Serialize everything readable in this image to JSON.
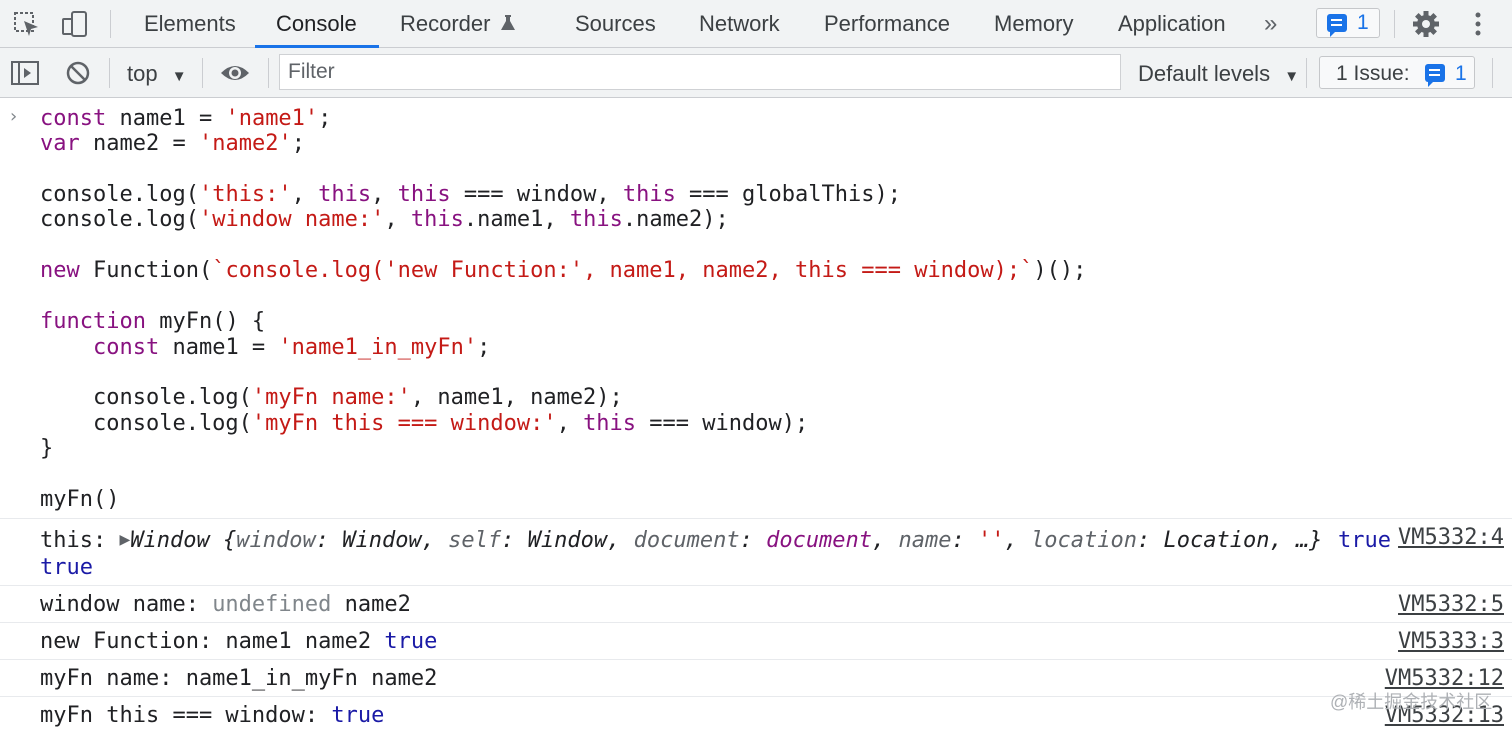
{
  "tabs": {
    "items": [
      "Elements",
      "Console",
      "Recorder",
      "Sources",
      "Network",
      "Performance",
      "Memory",
      "Application"
    ],
    "active": "Console",
    "messages_count": "1"
  },
  "toolbar": {
    "context": "top",
    "filter_placeholder": "Filter",
    "levels": "Default levels",
    "issues_label": "1 Issue:",
    "issues_count": "1"
  },
  "code": {
    "line1": [
      "const",
      " name1 = ",
      "'name1'",
      ";"
    ],
    "line2": [
      "var",
      " name2 = ",
      "'name2'",
      ";"
    ],
    "line3": [
      "console.log(",
      "'this:'",
      ", ",
      "this",
      ", ",
      "this",
      " === window, ",
      "this",
      " === globalThis);"
    ],
    "line4": [
      "console.log(",
      "'window name:'",
      ", ",
      "this",
      ".name1, ",
      "this",
      ".name2);"
    ],
    "line5": [
      "new",
      " Function(",
      "`console.log('new Function:', name1, name2, this === window);`",
      ")();"
    ],
    "line6": [
      "function",
      " myFn() {"
    ],
    "line7": [
      "    ",
      "const",
      " name1 = ",
      "'name1_in_myFn'",
      ";"
    ],
    "line8": [
      "    console.log(",
      "'myFn name:'",
      ", name1, name2);"
    ],
    "line9": [
      "    console.log(",
      "'myFn this === window:'",
      ", ",
      "this",
      " === window);"
    ],
    "line10": "}",
    "line11": "myFn()"
  },
  "output": {
    "row1": {
      "label": "this: ",
      "parts": [
        "Window {",
        "window",
        ": Window, ",
        "self",
        ": Window, ",
        "document",
        ": ",
        "document",
        ", ",
        "name",
        ": ",
        "''",
        ", ",
        "location",
        ": Location, …}"
      ],
      "after": "true",
      "second_line": "true",
      "source": "VM5332:4"
    },
    "row2": {
      "label": "window name: ",
      "undef": "undefined",
      "rest": " name2",
      "source": "VM5332:5"
    },
    "row3": {
      "label": "new Function: name1 name2 ",
      "bool": "true",
      "source": "VM5333:3"
    },
    "row4": {
      "label": "myFn name: name1_in_myFn name2",
      "source": "VM5332:12"
    },
    "row5": {
      "label": "myFn this === window: ",
      "bool": "true",
      "source": "VM5332:13"
    }
  },
  "watermark": "@稀土掘金技术社区"
}
